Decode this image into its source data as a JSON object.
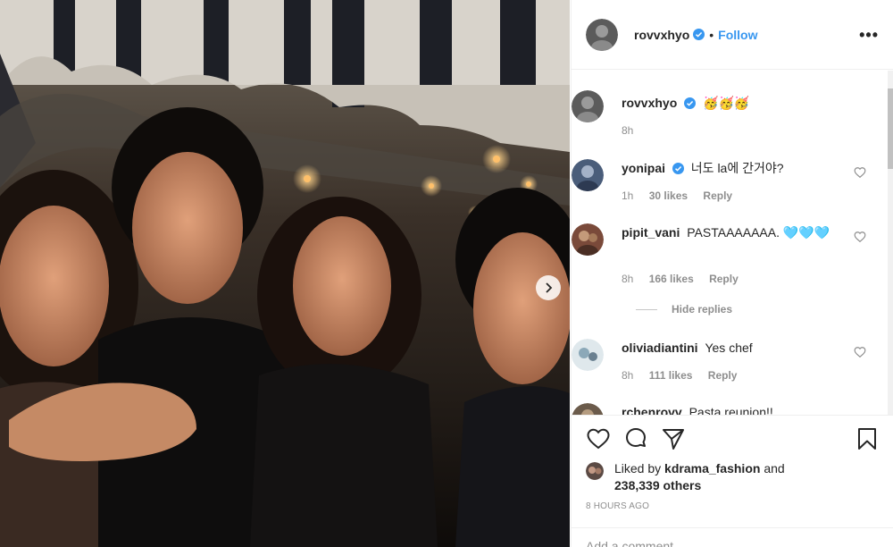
{
  "post": {
    "author": "rovvxhyo",
    "follow_label": "Follow",
    "separator": "•",
    "more_label": "•••",
    "caption_emojis": "🥳🥳🥳",
    "caption_time": "8h"
  },
  "comments": [
    {
      "user": "yonipai",
      "verified": true,
      "text": "너도 la에 간거야?",
      "time": "1h",
      "likes": "30 likes",
      "reply": "Reply",
      "avatar_color": "#4a5d7a"
    },
    {
      "user": "pipit_vani",
      "verified": false,
      "text": "PASTAAAAAAA. 🩵🩵🩵",
      "time": "8h",
      "likes": "166 likes",
      "reply": "Reply",
      "avatar_color": "#7a4a3a"
    },
    {
      "user": "oliviadiantini",
      "verified": false,
      "text": "Yes chef",
      "time": "8h",
      "likes": "111 likes",
      "reply": "Reply",
      "avatar_color": "#8ba8b8"
    },
    {
      "user": "rchenrovv",
      "verified": false,
      "text": "Pasta reunion!!",
      "avatar_color": "#6b5b4b"
    }
  ],
  "hide_replies_label": "Hide replies",
  "likes": {
    "prefix": "Liked by",
    "user": "kdrama_fashion",
    "and": "and",
    "count": "238,339 others"
  },
  "timestamp": "8 HOURS AGO",
  "add_comment_placeholder": "Add a comment...",
  "icons": {
    "like": "heart-icon",
    "comment": "comment-icon",
    "share": "share-icon",
    "save": "bookmark-icon",
    "verified": "verified-badge-icon",
    "next": "chevron-right-icon"
  },
  "colors": {
    "accent": "#3897f0",
    "muted": "#8e8e8e",
    "text": "#262626"
  }
}
